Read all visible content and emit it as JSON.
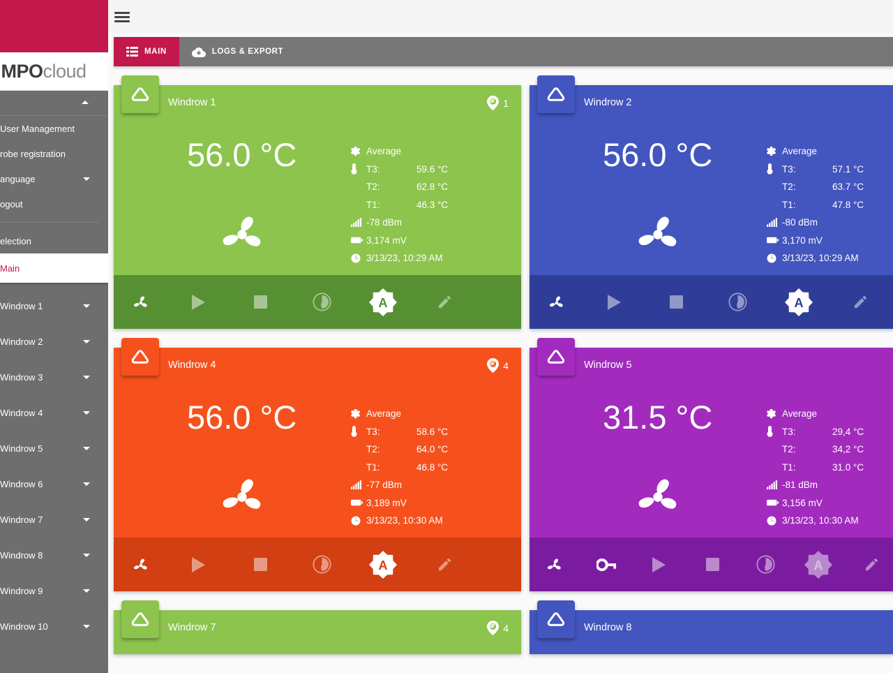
{
  "brand": {
    "name_bold": "MPO",
    "name_light": "cloud"
  },
  "sidebar": {
    "items": [
      {
        "label": "User Management",
        "caret": false
      },
      {
        "label": "robe registration",
        "caret": false
      },
      {
        "label": "anguage",
        "caret": true
      },
      {
        "label": "ogout",
        "caret": false
      }
    ],
    "selection_label": "election",
    "active_label": "Main",
    "windrows": [
      {
        "label": "Windrow 1"
      },
      {
        "label": "Windrow 2"
      },
      {
        "label": "Windrow 3"
      },
      {
        "label": "Windrow 4"
      },
      {
        "label": "Windrow 5"
      },
      {
        "label": "Windrow 6"
      },
      {
        "label": "Windrow 7"
      },
      {
        "label": "Windrow 8"
      },
      {
        "label": "Windrow 9"
      },
      {
        "label": "Windrow 10"
      }
    ]
  },
  "tabs": [
    {
      "label": "MAIN",
      "icon": "list-icon",
      "active": true
    },
    {
      "label": "LOGS & EXPORT",
      "icon": "cloud-download-icon",
      "active": false
    }
  ],
  "labels": {
    "average": "Average",
    "t3": "T3:",
    "t2": "T2:",
    "t1": "T1:"
  },
  "colors": {
    "brand_crimson": "#c2184b",
    "sidebar_grey": "#6e6e6e",
    "tabbar_grey": "#777777",
    "green": "#8cc44e",
    "green_dark": "#569033",
    "blue": "#4355be",
    "blue_dark": "#2f3d98",
    "orange": "#f6511d",
    "orange_dark": "#d23f12",
    "purple": "#a22bbe",
    "purple_dark": "#7b1ca0"
  },
  "cards": [
    {
      "title": "Windrow 1",
      "color": "#8cc44e",
      "toolbar_color": "#569033",
      "location": "1",
      "temperature": "56.0 °C",
      "t3": "59.6 °C",
      "t2": "62.8 °C",
      "t1": "46.3 °C",
      "signal": "-78 dBm",
      "battery": "3,174 mV",
      "timestamp": "3/13/23, 10:29 AM",
      "auto_active": true,
      "has_key": false,
      "short": false
    },
    {
      "title": "Windrow 2",
      "color": "#4355be",
      "toolbar_color": "#2f3d98",
      "location": null,
      "temperature": "56.0 °C",
      "t3": "57.1 °C",
      "t2": "63.7 °C",
      "t1": "47.8 °C",
      "signal": "-80 dBm",
      "battery": "3,170 mV",
      "timestamp": "3/13/23, 10:29 AM",
      "auto_active": true,
      "has_key": false,
      "short": false
    },
    {
      "title": "Windrow 4",
      "color": "#f6511d",
      "toolbar_color": "#d23f12",
      "location": "4",
      "temperature": "56.0 °C",
      "t3": "58.6 °C",
      "t2": "64.0 °C",
      "t1": "46.8 °C",
      "signal": "-77 dBm",
      "battery": "3,189 mV",
      "timestamp": "3/13/23, 10:30 AM",
      "auto_active": true,
      "has_key": false,
      "short": false
    },
    {
      "title": "Windrow 5",
      "color": "#a22bbe",
      "toolbar_color": "#7b1ca0",
      "location": null,
      "temperature": "31.5 °C",
      "t3": "29,4 °C",
      "t2": "34,2 °C",
      "t1": "31.0 °C",
      "signal": "-81 dBm",
      "battery": "3,156 mV",
      "timestamp": "3/13/23, 10:30 AM",
      "auto_active": false,
      "has_key": true,
      "short": false
    },
    {
      "title": "Windrow 7",
      "color": "#8cc44e",
      "toolbar_color": "#569033",
      "location": "4",
      "temperature": null,
      "t3": null,
      "t2": null,
      "t1": null,
      "signal": null,
      "battery": null,
      "timestamp": null,
      "auto_active": true,
      "has_key": false,
      "short": true
    },
    {
      "title": "Windrow 8",
      "color": "#4355be",
      "toolbar_color": "#2f3d98",
      "location": null,
      "temperature": null,
      "t3": null,
      "t2": null,
      "t1": null,
      "signal": null,
      "battery": null,
      "timestamp": null,
      "auto_active": true,
      "has_key": false,
      "short": true
    }
  ]
}
